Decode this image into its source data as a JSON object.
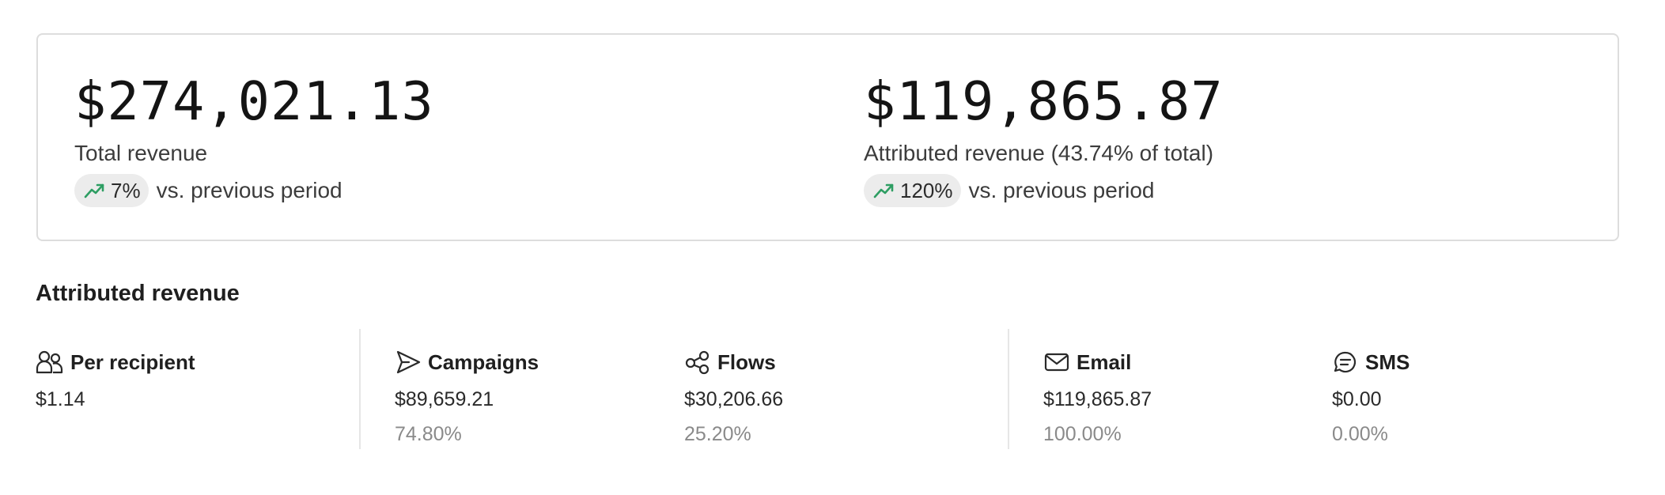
{
  "summary": {
    "total": {
      "value": "$274,021.13",
      "label": "Total revenue",
      "change": "7%",
      "change_suffix": "vs. previous period",
      "trend_icon": "trending-up-icon"
    },
    "attributed": {
      "value": "$119,865.87",
      "label": "Attributed revenue (43.74% of total)",
      "change": "120%",
      "change_suffix": "vs. previous period",
      "trend_icon": "trending-up-icon"
    }
  },
  "breakdown": {
    "title": "Attributed revenue",
    "metrics": [
      {
        "name": "Per recipient",
        "icon": "users-icon",
        "value": "$1.14",
        "percent": ""
      },
      {
        "name": "Campaigns",
        "icon": "send-icon",
        "value": "$89,659.21",
        "percent": "74.80%"
      },
      {
        "name": "Flows",
        "icon": "flows-icon",
        "value": "$30,206.66",
        "percent": "25.20%"
      },
      {
        "name": "Email",
        "icon": "mail-icon",
        "value": "$119,865.87",
        "percent": "100.00%"
      },
      {
        "name": "SMS",
        "icon": "message-icon",
        "value": "$0.00",
        "percent": "0.00%"
      }
    ]
  },
  "colors": {
    "trend_up": "#2e9e63",
    "border": "#dddddd",
    "pill_bg": "#ececec",
    "muted_text": "#8a8a8a"
  }
}
